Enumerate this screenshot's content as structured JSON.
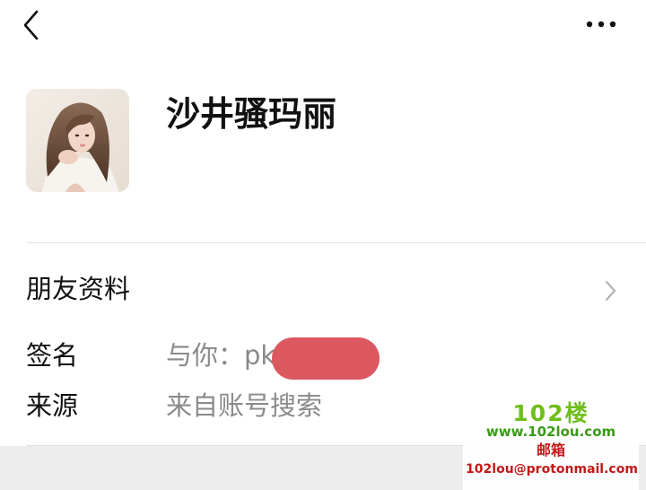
{
  "header": {
    "back_icon": "chevron-left-icon",
    "more_icon": "more-dots-icon"
  },
  "profile": {
    "name": "沙井骚玛丽",
    "avatar": "avatar-photo"
  },
  "info": {
    "friend_info_label": "朋友资料",
    "chevron_icon": "chevron-right-icon",
    "signature_label": "签名",
    "signature_value": "与你：pk",
    "source_label": "来源",
    "source_value": "来自账号搜索"
  },
  "watermark": {
    "brand": "102楼",
    "url": "www.102lou.com",
    "mail_label": "邮箱",
    "email": "102lou@protonmail.com"
  },
  "colors": {
    "redaction": "#dc5860",
    "watermark_green": "#6fbe1a",
    "watermark_red": "#c41818"
  }
}
